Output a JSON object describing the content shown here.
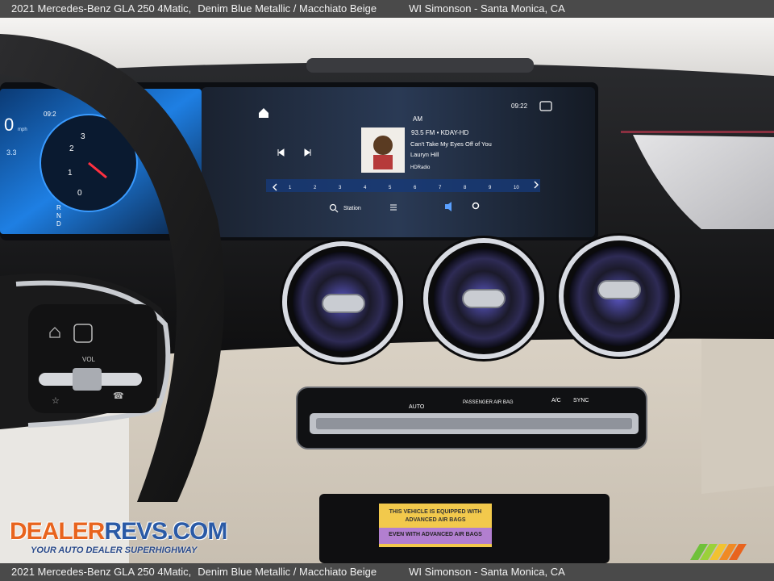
{
  "caption": {
    "title": "2021 Mercedes-Benz GLA 250 4Matic,",
    "color": "Denim Blue Metallic / Macchiato Beige",
    "dealer": "WI Simonson - Santa Monica, CA"
  },
  "screen": {
    "time": "09:22",
    "band": "AM",
    "station": "93.5 FM • KDAY-HD",
    "song": "Can't Take My Eyes Off of You",
    "artist": "Lauryn Hill",
    "source_badge": "HDRadio",
    "station_button": "Station",
    "presets": [
      "1",
      "2",
      "3",
      "4",
      "5",
      "6",
      "7",
      "8",
      "9",
      "10"
    ]
  },
  "cluster": {
    "speed": "0",
    "speed_unit": "mph",
    "time": "09:2",
    "trip": "3.3",
    "gear_letters": [
      "R",
      "N",
      "D"
    ],
    "tach": [
      "2",
      "3",
      "1",
      "0"
    ]
  },
  "climate": {
    "auto": "AUTO",
    "passenger_airbag": "PASSENGER AIR BAG",
    "ac": "A/C",
    "sync": "SYNC"
  },
  "wheel": {
    "vol": "VOL"
  },
  "sticker": {
    "line1": "THIS VEHICLE IS EQUIPPED WITH",
    "line2": "ADVANCED AIR BAGS",
    "line3": "EVEN WITH ADVANCED AIR BAGS"
  },
  "watermark": {
    "logo_a": "DEALER",
    "logo_b": "REVS.COM",
    "tagline": "YOUR AUTO DEALER SUPERHIGHWAY"
  },
  "colors": {
    "bar_bg": "#4a4a4a",
    "screen_bg": "#12161d",
    "screen_blue": "#2d7fe0",
    "dash_beige": "#d9d2c6",
    "dash_black": "#141414",
    "vent_chrome": "#dadde3",
    "vent_glow": "#6e6ad8",
    "wm_orange": "#e8641e",
    "wm_blue": "#2a5aa6"
  }
}
